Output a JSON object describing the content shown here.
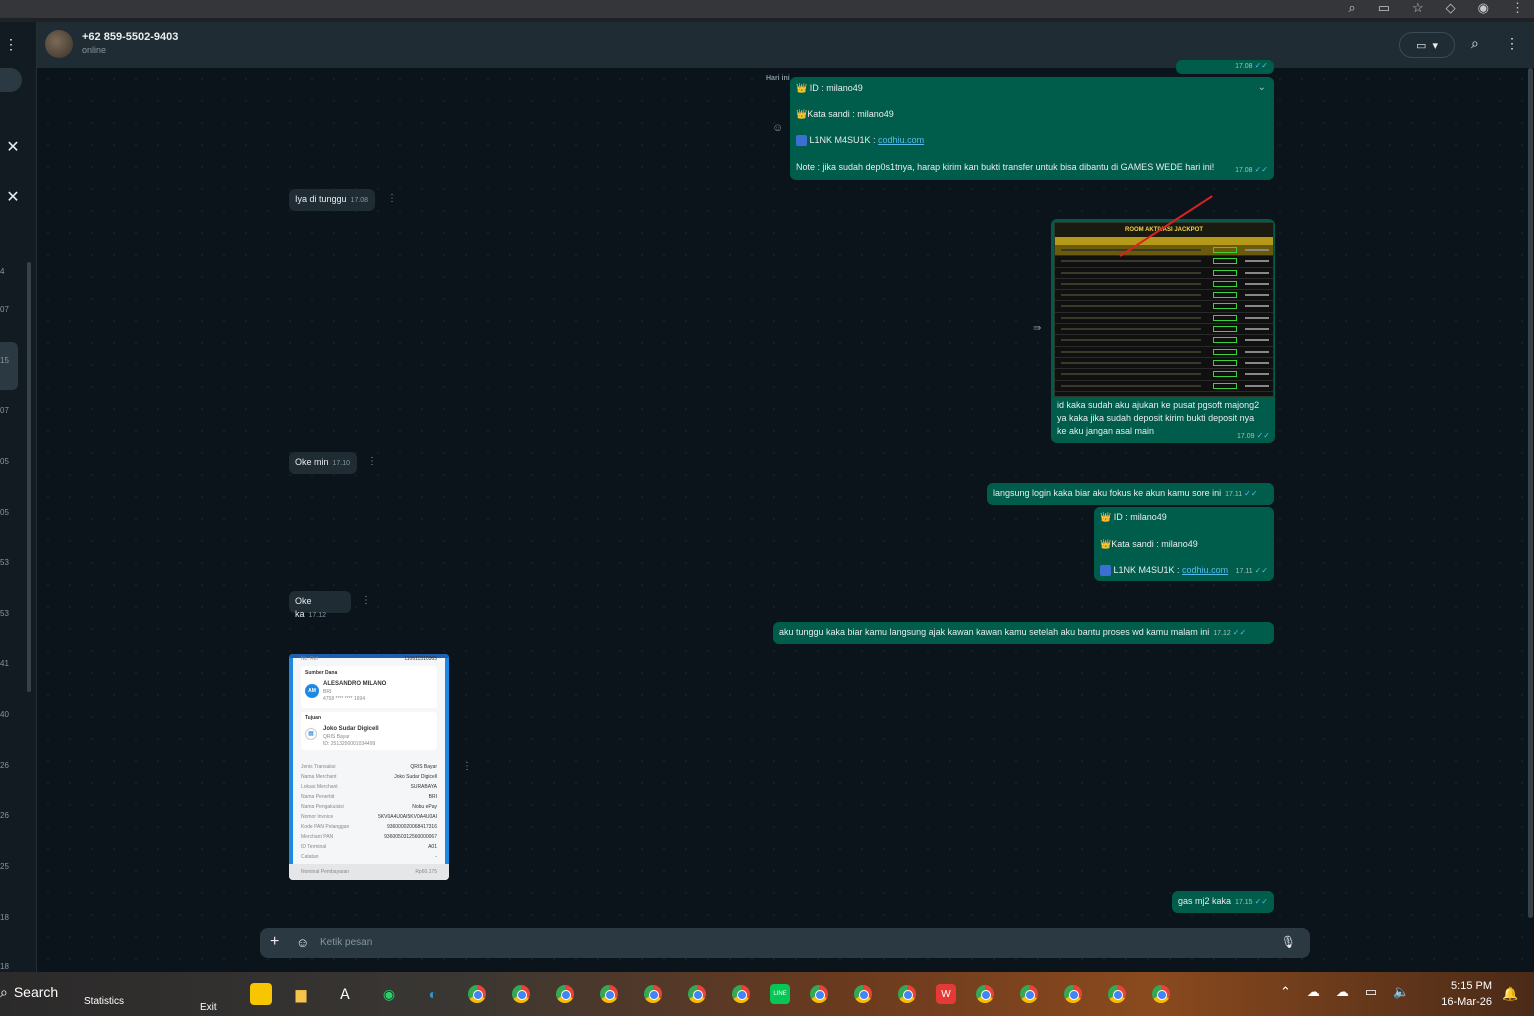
{
  "header": {
    "contact_name": "+62 859-5502-9403",
    "status": "online",
    "video_icon": "video-camera-icon",
    "search_icon": "search-icon",
    "menu_icon": "kebab-icon"
  },
  "left_strip": {
    "numbers": [
      "4",
      "07",
      "15",
      "07",
      "05",
      "05",
      "53",
      "53",
      "41",
      "40",
      "26",
      "26",
      "25",
      "18",
      "18"
    ]
  },
  "chat": {
    "date_chip": "Hari ini",
    "messages": [
      {
        "type": "out",
        "lines": [
          "ID :  milano49",
          "Kata sandi : milano49",
          "L1NK M4SU1K : ",
          "Note : jika sudah dep0s1tnya, harap kirim kan bukti transfer untuk bisa dibantu di GAMES WEDE hari ini!"
        ],
        "link": "codhiu.com",
        "time": "17.08"
      },
      {
        "type": "in",
        "text": "Iya di tunggu",
        "time": "17.08"
      },
      {
        "type": "out",
        "image_title": "ROOM AKTIVASI JACKPOT",
        "lines": [
          "id kaka sudah aku ajukan ke pusat pgsoft majong2",
          "ya kaka jika sudah deposit kirim bukti deposit nya",
          "ke aku jangan asal main"
        ],
        "time": "17.09"
      },
      {
        "type": "in",
        "text": "Oke min",
        "time": "17.10"
      },
      {
        "type": "out",
        "text": "langsung login kaka biar aku fokus ke akun kamu sore ini",
        "time": "17.11"
      },
      {
        "type": "out",
        "lines": [
          "ID :  milano49",
          "Kata sandi : milano49",
          "L1NK M4SU1K : "
        ],
        "link": "codhiu.com",
        "time": "17.11"
      },
      {
        "type": "in",
        "text": "Oke ka",
        "time": "17.12"
      },
      {
        "type": "out",
        "text": "aku tunggu kaka biar kamu langsung ajak kawan kawan kamu setelah aku bantu proses wd kamu malam ini",
        "time": "17.12"
      },
      {
        "type": "out",
        "text": "gas mj2 kaka",
        "time": "17.15"
      }
    ],
    "receipt": {
      "no_ref_label": "No. Ref",
      "no_ref": "110611310365",
      "sumber_label": "Sumber Dana",
      "initials": "AM",
      "sender": "ALESANDRO MILANO",
      "sender_bank": "BRI",
      "sender_acct": "4758 **** **** 1694",
      "tujuan_label": "Tujuan",
      "merchant": "Joko Sudar Digicell",
      "merchant_sub": "QRIS Bayar",
      "merchant_id": "ID: 2513200001034499",
      "rows": [
        {
          "k": "Jenis Transaksi",
          "v": "QRIS Bayar"
        },
        {
          "k": "Nama Merchant",
          "v": "Joko Sudar Digicell"
        },
        {
          "k": "Lokasi Merchant",
          "v": "SURABAYA"
        },
        {
          "k": "Nama Penerbit",
          "v": "BRI"
        },
        {
          "k": "Nama Pengakuisisi",
          "v": "Nobu ePay"
        },
        {
          "k": "Nomor Invoice",
          "v": "5KV0A4U0AI5KV0A4U0AI"
        },
        {
          "k": "Kode PAN Pelanggan",
          "v": "936000020068417316"
        },
        {
          "k": "Merchant PAN",
          "v": "9360050312560000067"
        },
        {
          "k": "ID Terminal",
          "v": "A01"
        },
        {
          "k": "Catatan",
          "v": "-"
        }
      ],
      "footer_label": "Nominal Pembayaran",
      "footer_value": "Rp60.175"
    }
  },
  "input": {
    "placeholder": "Ketik pesan"
  },
  "taskbar": {
    "search": "Search",
    "widget": "Statistics",
    "exit": "Exit",
    "time": "5:15 PM",
    "date": "16-Mar-26"
  }
}
